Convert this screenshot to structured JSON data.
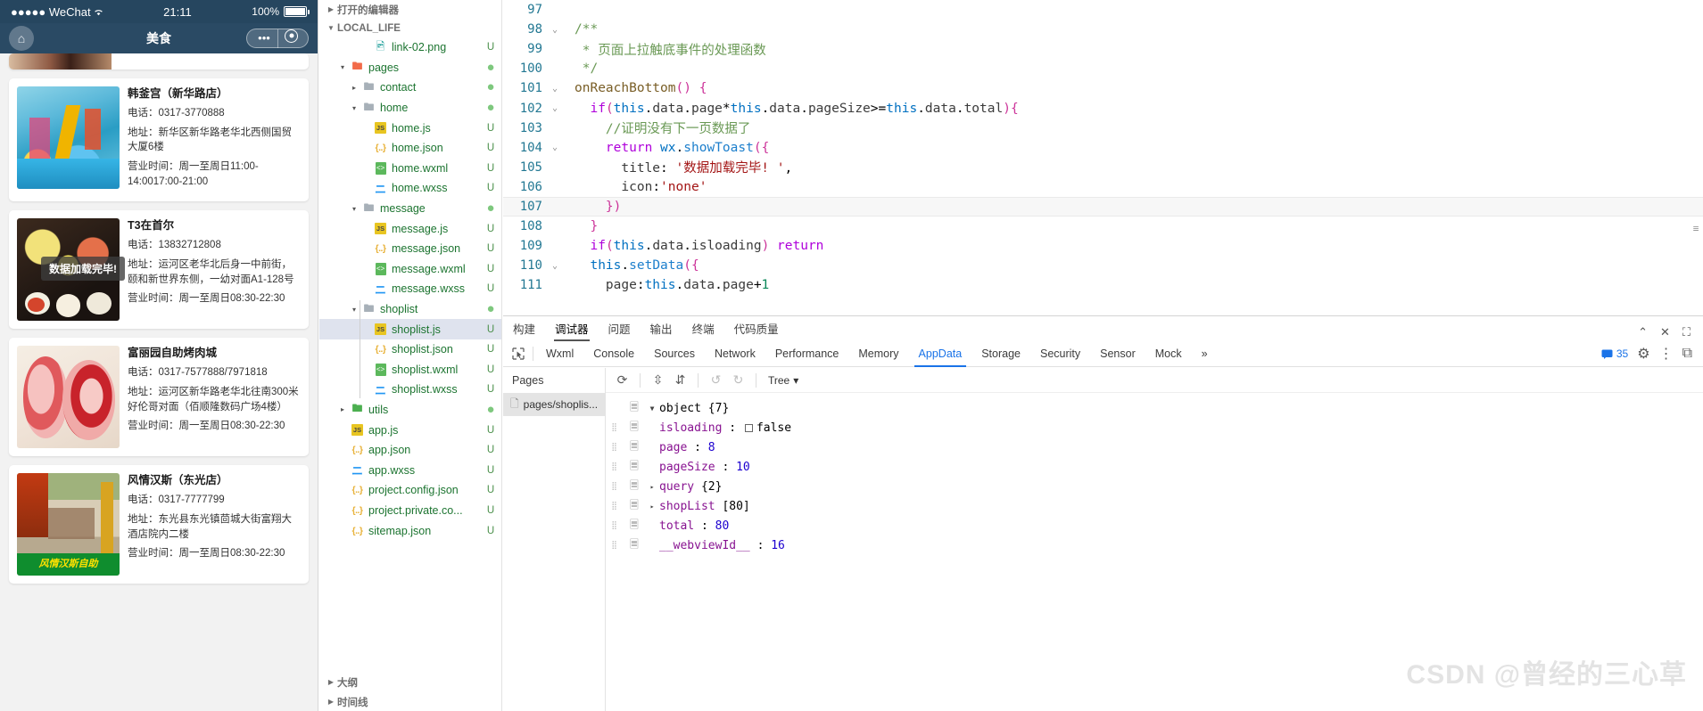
{
  "simulator": {
    "status_bar": {
      "carrier": "●●●●● WeChat",
      "wifi_icon": "wifi-icon",
      "time": "21:11",
      "battery": "100%"
    },
    "nav_bar": {
      "home_icon": "home-icon",
      "title": "美食",
      "more_icon": "more-dots-icon",
      "target_icon": "target-icon"
    },
    "toast": "数据加载完毕!",
    "labels": {
      "phone": "电话：",
      "address": "地址：",
      "hours": "营业时间："
    },
    "shops": [
      {
        "name": "韩釜宫（新华路店）",
        "phone": "电话：0317-3770888",
        "address": "地址：新华区新华路老华北西侧国贸大厦6楼",
        "hours": "营业时间：周一至周日11:00-14:0017:00-21:00",
        "photo": "indoor-playground-photo"
      },
      {
        "name": "T3在首尔",
        "phone": "电话：13832712808",
        "address": "地址：运河区老华北后身一中前街，颐和新世界东侧，一幼对面A1-128号",
        "hours": "营业时间：周一至周日08:30-22:30",
        "photo": "korean-food-platter-photo"
      },
      {
        "name": "富丽园自助烤肉城",
        "phone": "电话：0317-7577888/7971818",
        "address": "地址：运河区新华路老华北往南300米好伦哥对面（佰顺隆数码广场4楼）",
        "hours": "营业时间：周一至周日08:30-22:30",
        "photo": "raw-meat-rolls-photo"
      },
      {
        "name": "风情汉斯（东光店）",
        "phone": "电话：0317-7777799",
        "address": "地址：东光县东光镇茴城大街富翔大酒店院内二楼",
        "hours": "营业时间：周一至周日08:30-22:30",
        "photo": "restaurant-hall-photo",
        "overlay_text": "风情汉斯自助"
      }
    ]
  },
  "explorer": {
    "sections": [
      {
        "label": "打开的编辑器",
        "expanded": false
      },
      {
        "label": "LOCAL_LIFE",
        "expanded": true
      },
      {
        "label": "大纲",
        "expanded": false
      },
      {
        "label": "时间线",
        "expanded": false
      }
    ],
    "items": [
      {
        "label": "link-02.png",
        "icon": "image-file-icon",
        "indent": 3,
        "twisty": "",
        "mark": "U"
      },
      {
        "label": "pages",
        "icon": "folder-pages-icon",
        "indent": 1,
        "twisty": "▾",
        "mark": "●"
      },
      {
        "label": "contact",
        "icon": "folder-icon",
        "indent": 2,
        "twisty": "▸",
        "mark": "●"
      },
      {
        "label": "home",
        "icon": "folder-open-icon",
        "indent": 2,
        "twisty": "▾",
        "mark": "●"
      },
      {
        "label": "home.js",
        "icon": "js-file-icon",
        "indent": 3,
        "twisty": "",
        "mark": "U"
      },
      {
        "label": "home.json",
        "icon": "json-file-icon",
        "indent": 3,
        "twisty": "",
        "mark": "U"
      },
      {
        "label": "home.wxml",
        "icon": "wxml-file-icon",
        "indent": 3,
        "twisty": "",
        "mark": "U"
      },
      {
        "label": "home.wxss",
        "icon": "wxss-file-icon",
        "indent": 3,
        "twisty": "",
        "mark": "U"
      },
      {
        "label": "message",
        "icon": "folder-open-icon",
        "indent": 2,
        "twisty": "▾",
        "mark": "●"
      },
      {
        "label": "message.js",
        "icon": "js-file-icon",
        "indent": 3,
        "twisty": "",
        "mark": "U"
      },
      {
        "label": "message.json",
        "icon": "json-file-icon",
        "indent": 3,
        "twisty": "",
        "mark": "U"
      },
      {
        "label": "message.wxml",
        "icon": "wxml-file-icon",
        "indent": 3,
        "twisty": "",
        "mark": "U"
      },
      {
        "label": "message.wxss",
        "icon": "wxss-file-icon",
        "indent": 3,
        "twisty": "",
        "mark": "U"
      },
      {
        "label": "shoplist",
        "icon": "folder-open-icon",
        "indent": 2,
        "twisty": "▾",
        "mark": "●"
      },
      {
        "label": "shoplist.js",
        "icon": "js-file-icon",
        "indent": 3,
        "twisty": "",
        "mark": "U",
        "selected": true
      },
      {
        "label": "shoplist.json",
        "icon": "json-file-icon",
        "indent": 3,
        "twisty": "",
        "mark": "U"
      },
      {
        "label": "shoplist.wxml",
        "icon": "wxml-file-icon",
        "indent": 3,
        "twisty": "",
        "mark": "U"
      },
      {
        "label": "shoplist.wxss",
        "icon": "wxss-file-icon",
        "indent": 3,
        "twisty": "",
        "mark": "U"
      },
      {
        "label": "utils",
        "icon": "folder-utils-icon",
        "indent": 1,
        "twisty": "▸",
        "mark": "●"
      },
      {
        "label": "app.js",
        "icon": "js-file-icon",
        "indent": 1,
        "twisty": "",
        "mark": "U"
      },
      {
        "label": "app.json",
        "icon": "json-file-icon",
        "indent": 1,
        "twisty": "",
        "mark": "U"
      },
      {
        "label": "app.wxss",
        "icon": "wxss-file-icon",
        "indent": 1,
        "twisty": "",
        "mark": "U"
      },
      {
        "label": "project.config.json",
        "icon": "json-file-icon",
        "indent": 1,
        "twisty": "",
        "mark": "U"
      },
      {
        "label": "project.private.co...",
        "icon": "json-file-icon",
        "indent": 1,
        "twisty": "",
        "mark": "U"
      },
      {
        "label": "sitemap.json",
        "icon": "json-file-icon",
        "indent": 1,
        "twisty": "",
        "mark": "U"
      }
    ]
  },
  "editor": {
    "lines": [
      {
        "num": "97",
        "fold": "",
        "current": false
      },
      {
        "num": "98",
        "fold": "⌄",
        "current": false
      },
      {
        "num": "99",
        "fold": "",
        "current": false
      },
      {
        "num": "100",
        "fold": "",
        "current": false
      },
      {
        "num": "101",
        "fold": "⌄",
        "current": false
      },
      {
        "num": "102",
        "fold": "⌄",
        "current": false
      },
      {
        "num": "103",
        "fold": "",
        "current": false
      },
      {
        "num": "104",
        "fold": "⌄",
        "current": false
      },
      {
        "num": "105",
        "fold": "",
        "current": false
      },
      {
        "num": "106",
        "fold": "",
        "current": false
      },
      {
        "num": "107",
        "fold": "",
        "current": true
      },
      {
        "num": "108",
        "fold": "",
        "current": false
      },
      {
        "num": "109",
        "fold": "",
        "current": false
      },
      {
        "num": "110",
        "fold": "⌄",
        "current": false
      },
      {
        "num": "111",
        "fold": "",
        "current": false
      }
    ],
    "code_text": [
      "",
      "/**",
      " * 页面上拉触底事件的处理函数",
      " */",
      "onReachBottom() {",
      "  if(this.data.page*this.data.pageSize>=this.data.total){",
      "    //证明没有下一页数据了",
      "    return wx.showToast({",
      "      title: '数据加载完毕! ',",
      "      icon:'none'",
      "    })",
      "  }",
      "  if(this.data.isloading) return",
      "  this.setData({",
      "    page:this.data.page+1"
    ]
  },
  "devtools": {
    "panel_tabs": [
      "构建",
      "调试器",
      "问题",
      "输出",
      "终端",
      "代码质量"
    ],
    "panel_active": "调试器",
    "window_buttons": [
      "minimize-icon",
      "close-icon",
      "expand-icon"
    ],
    "inspector_tabs": [
      "Wxml",
      "Console",
      "Sources",
      "Network",
      "Performance",
      "Memory",
      "AppData",
      "Storage",
      "Security",
      "Sensor",
      "Mock"
    ],
    "inspector_active": "AppData",
    "overflow_icon": "»",
    "message_count": "35",
    "right_icons": [
      "gear-icon",
      "kebab-menu-icon",
      "dock-icon"
    ],
    "pages_header": "Pages",
    "pages_items": [
      "pages/shoplis..."
    ],
    "toolbar": {
      "refresh_icon": "refresh-icon",
      "expand_all_icon": "expand-all-icon",
      "collapse_all_icon": "collapse-all-icon",
      "undo_icon": "undo-icon",
      "redo_icon": "redo-icon",
      "view_mode": "Tree"
    },
    "appdata": {
      "root_label": "object",
      "root_count": "{7}",
      "rows": [
        {
          "key": "isloading",
          "sep": ":",
          "value": "false",
          "type": "bool",
          "twisty": ""
        },
        {
          "key": "page",
          "sep": ":",
          "value": "8",
          "type": "num",
          "twisty": ""
        },
        {
          "key": "pageSize",
          "sep": ":",
          "value": "10",
          "type": "num",
          "twisty": ""
        },
        {
          "key": "query",
          "sep": "",
          "value": "{2}",
          "type": "obj",
          "twisty": "▸"
        },
        {
          "key": "shopList",
          "sep": "",
          "value": "[80]",
          "type": "arr",
          "twisty": "▸"
        },
        {
          "key": "total",
          "sep": ":",
          "value": "80",
          "type": "num",
          "twisty": ""
        },
        {
          "key": "__webviewId__",
          "sep": ":",
          "value": "16",
          "type": "num",
          "twisty": ""
        }
      ]
    }
  },
  "watermark": "CSDN @曾经的三心草"
}
